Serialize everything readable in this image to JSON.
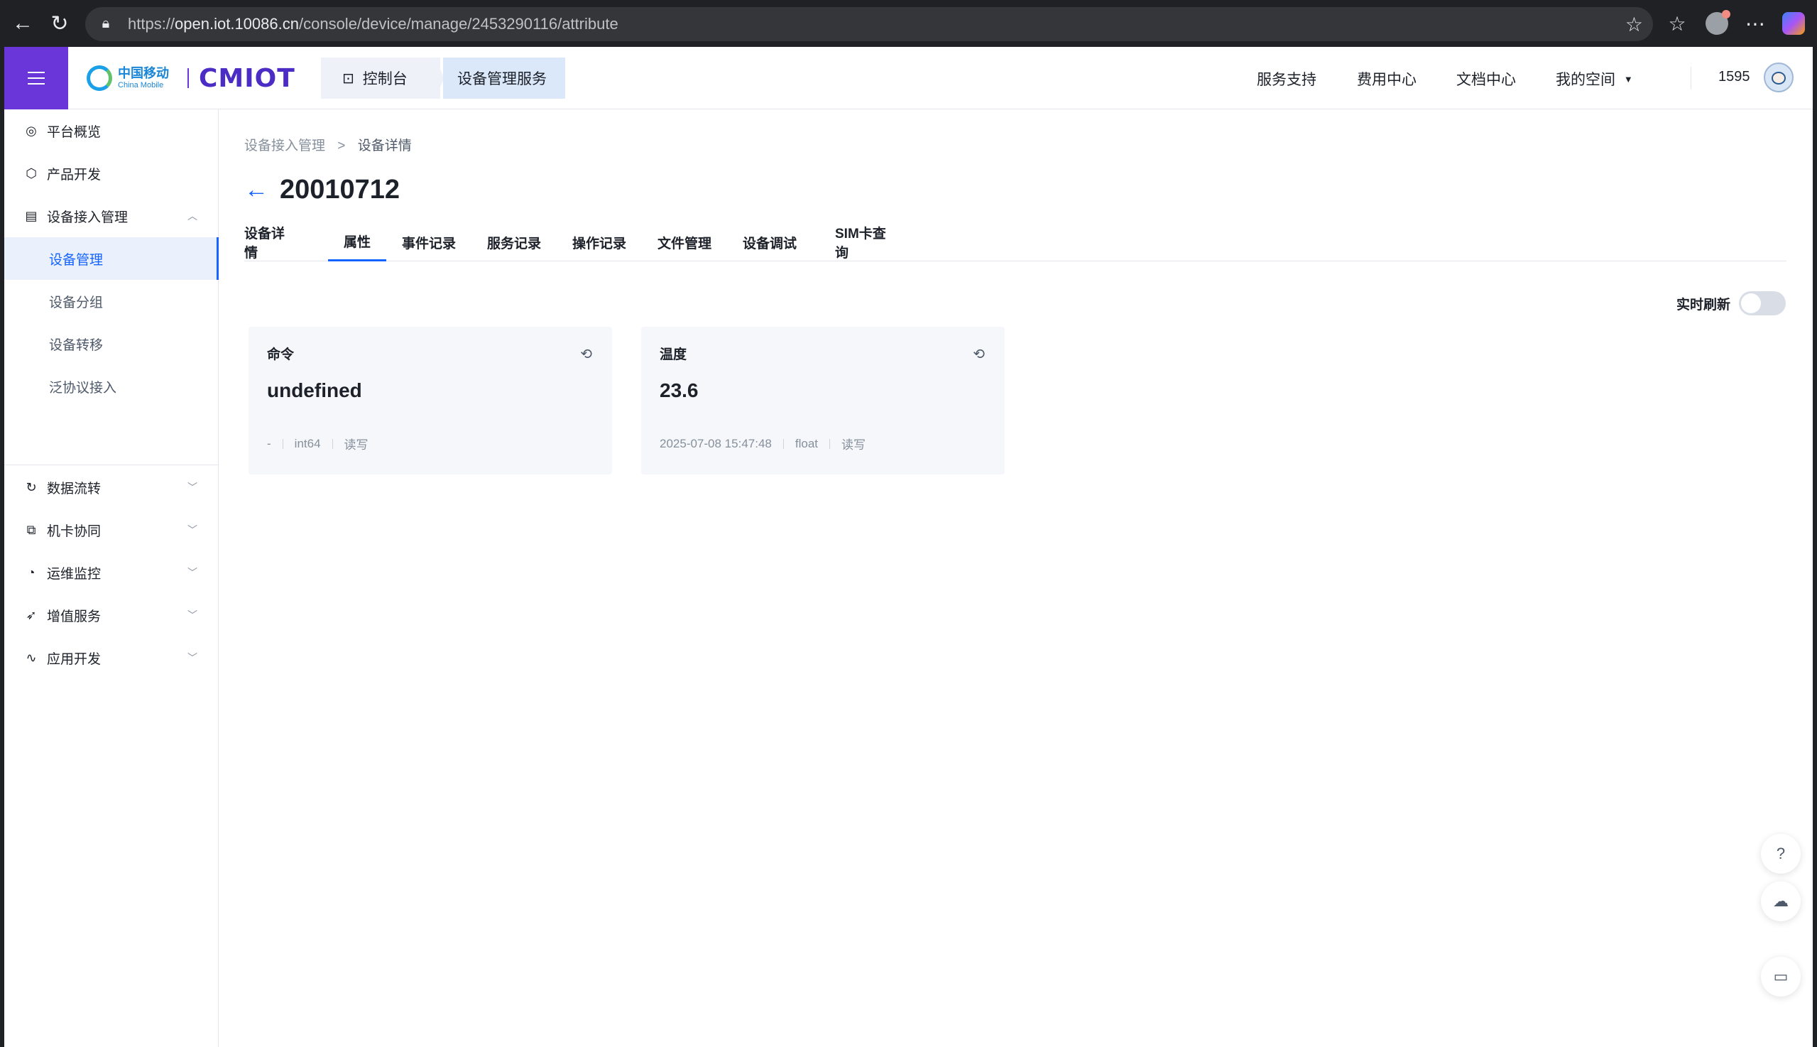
{
  "browser": {
    "url_prefix": "https://",
    "url_host": "open.iot.10086.cn",
    "url_path": "/console/device/manage/2453290116/attribute"
  },
  "header": {
    "logo_cn": "中国移动",
    "logo_en": "China Mobile",
    "logo_iot": "CMIOT",
    "crumb_console": "控制台",
    "crumb_service": "设备管理服务",
    "links": [
      "服务支持",
      "费用中心",
      "文档中心",
      "我的空间"
    ],
    "user_number": "1595"
  },
  "sidebar": {
    "items": [
      {
        "label": "平台概览",
        "icon": "overview-icon"
      },
      {
        "label": "产品开发",
        "icon": "cube-icon"
      },
      {
        "label": "设备接入管理",
        "icon": "device-icon"
      },
      {
        "label": "数据流转",
        "icon": "flow-icon"
      },
      {
        "label": "机卡协同",
        "icon": "link-icon"
      },
      {
        "label": "运维监控",
        "icon": "monitor-icon"
      },
      {
        "label": "增值服务",
        "icon": "send-icon"
      },
      {
        "label": "应用开发",
        "icon": "code-icon"
      }
    ],
    "sub_items": [
      "设备管理",
      "设备分组",
      "设备转移",
      "泛协议接入"
    ]
  },
  "main": {
    "breadcrumb": [
      "设备接入管理",
      "设备详情"
    ],
    "title": "20010712",
    "tabs": [
      "设备详情",
      "属性",
      "事件记录",
      "服务记录",
      "操作记录",
      "文件管理",
      "设备调试",
      "SIM卡查询"
    ],
    "active_tab": "属性",
    "realtime_label": "实时刷新",
    "realtime_on": false,
    "cards": [
      {
        "label": "命令",
        "value": "undefined",
        "time": "-",
        "type": "int64",
        "access": "读写"
      },
      {
        "label": "温度",
        "value": "23.6",
        "time": "2025-07-08 15:47:48",
        "type": "float",
        "access": "读写"
      }
    ]
  },
  "colors": {
    "brand_purple": "#6a35d9",
    "accent_blue": "#1664ff"
  }
}
